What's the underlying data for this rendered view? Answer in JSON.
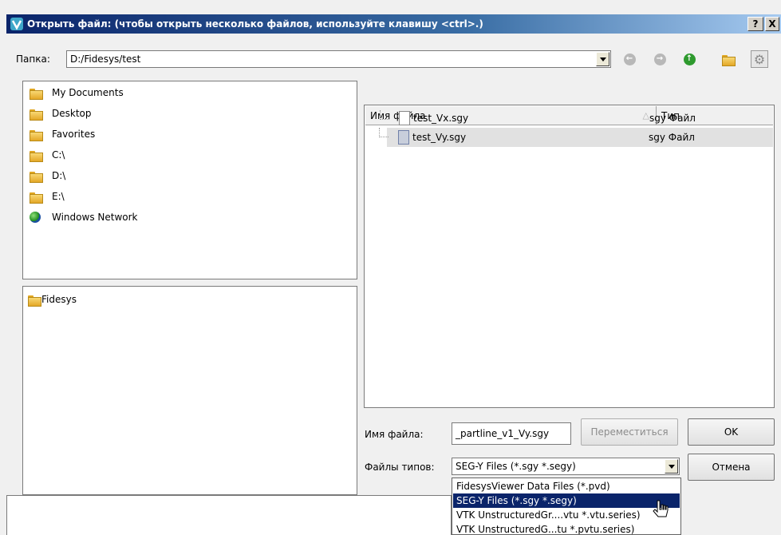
{
  "titlebar": {
    "title": "Открыть файл: (чтобы открыть несколько файлов, используйте клавишу <ctrl>.)",
    "help_label": "?",
    "close_label": "X"
  },
  "folder_bar": {
    "label": "Папка:",
    "path": "D:/Fidesys/test"
  },
  "sidebar": {
    "places": [
      {
        "label": "My Documents",
        "icon": "folder-icon"
      },
      {
        "label": "Desktop",
        "icon": "folder-icon"
      },
      {
        "label": "Favorites",
        "icon": "folder-icon"
      },
      {
        "label": "C:\\",
        "icon": "folder-icon"
      },
      {
        "label": "D:\\",
        "icon": "folder-icon"
      },
      {
        "label": "E:\\",
        "icon": "folder-icon"
      },
      {
        "label": "Windows Network",
        "icon": "network-globe-icon"
      }
    ],
    "recent": [
      {
        "label": "Fidesys",
        "icon": "folder-icon"
      }
    ]
  },
  "file_list": {
    "columns": [
      "Имя файла",
      "Тип"
    ],
    "rows": [
      {
        "name": "test_Vx.sgy",
        "type": "sgy Файл",
        "selected": false
      },
      {
        "name": "test_Vy.sgy",
        "type": "sgy Файл",
        "selected": true
      }
    ]
  },
  "filename": {
    "label": "Имя файла:",
    "value": "_partline_v1_Vy.sgy"
  },
  "filetype": {
    "label": "Файлы типов:",
    "value": "SEG-Y Files (*.sgy *.segy)",
    "options": [
      "FidesysViewer Data Files (*.pvd)",
      "SEG-Y Files (*.sgy *.segy)",
      "VTK UnstructuredGr....vtu *.vtu.series)",
      "VTK UnstructuredG...tu *.pvtu.series)"
    ],
    "selected_index": 1
  },
  "buttons": {
    "navigate": "Переместиться",
    "ok": "OK",
    "cancel": "Отмена"
  },
  "colors": {
    "title_bar": "#0a246a",
    "selection": "#0a246a",
    "up_button": "#2e9a2e"
  }
}
